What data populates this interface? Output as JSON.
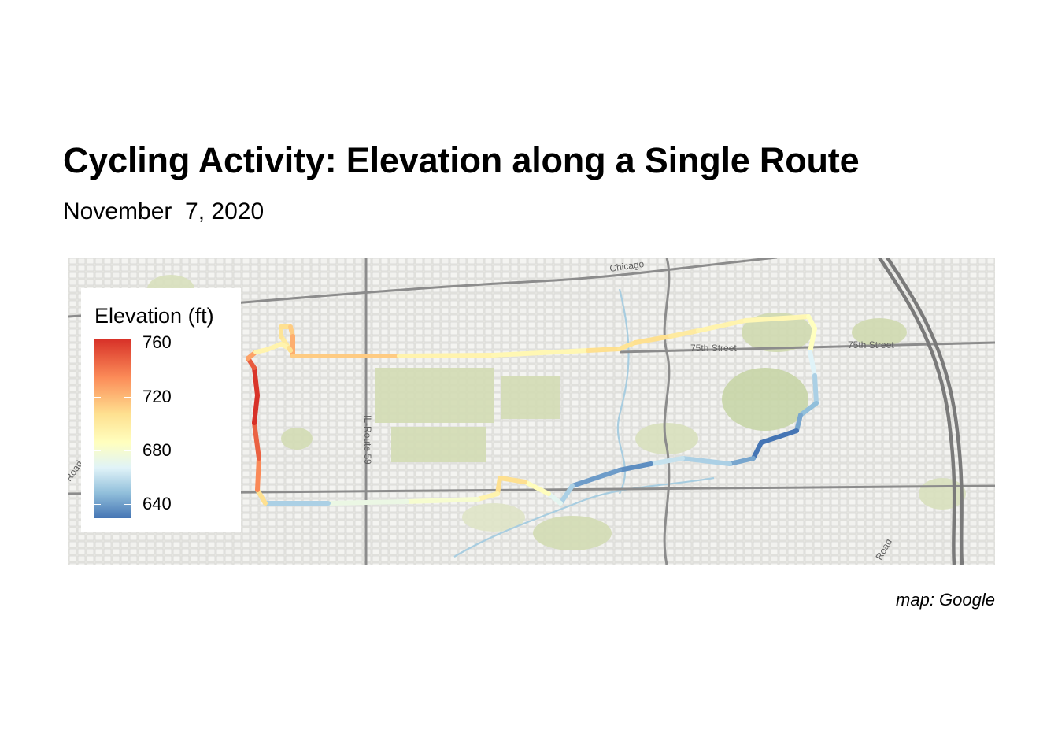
{
  "header": {
    "title": "Cycling Activity: Elevation along a Single Route",
    "subtitle": "November  7, 2020"
  },
  "map": {
    "source_caption": "map: Google",
    "street_labels": [
      "Chicago",
      "75th Street",
      "75th Street",
      "IL-Route 59",
      "Road",
      "Road"
    ]
  },
  "legend": {
    "title": "Elevation (ft)",
    "ticks": [
      "760",
      "720",
      "680",
      "640"
    ],
    "colors": {
      "high": "#d73027",
      "upper": "#fc8d59",
      "mid_high": "#fee090",
      "mid": "#ffffbf",
      "mid_low": "#e0f3f8",
      "lower": "#91bfdb",
      "low": "#4575b4"
    }
  },
  "route": {
    "unit": "ft",
    "segment_elevations": [
      695,
      698,
      700,
      705,
      712,
      705,
      690,
      688,
      700,
      698,
      700,
      695,
      690,
      688,
      684,
      684,
      670,
      660,
      655,
      650,
      640,
      636,
      650,
      660,
      665,
      645,
      648,
      660,
      672,
      685,
      700,
      700,
      690,
      680,
      675,
      660,
      700,
      722,
      740,
      762,
      760,
      742,
      715,
      690,
      690,
      690,
      686,
      700
    ]
  }
}
